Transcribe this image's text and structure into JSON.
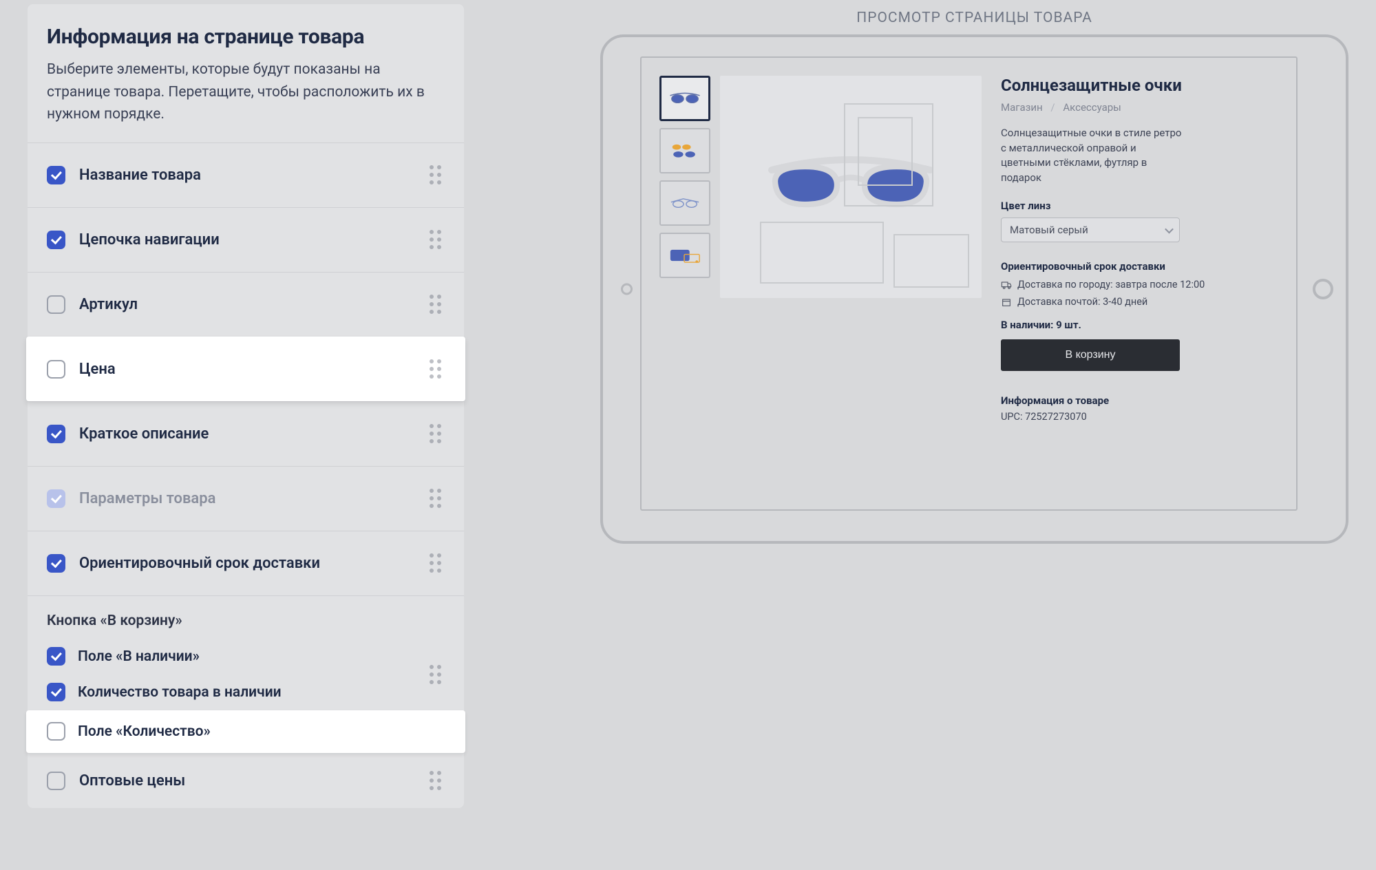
{
  "panel": {
    "title": "Информация на странице товара",
    "subtitle": "Выберите элементы, которые будут показаны на странице товара. Перетащите, чтобы расположить их в нужном порядке."
  },
  "items": [
    {
      "label": "Название товара",
      "checked": true,
      "state": "normal"
    },
    {
      "label": "Цепочка навигации",
      "checked": true,
      "state": "normal"
    },
    {
      "label": "Артикул",
      "checked": false,
      "state": "normal"
    },
    {
      "label": "Цена",
      "checked": false,
      "state": "active"
    },
    {
      "label": "Краткое описание",
      "checked": true,
      "state": "normal"
    },
    {
      "label": "Параметры товара",
      "checked": true,
      "state": "disabled"
    },
    {
      "label": "Ориентировочный срок доставки",
      "checked": true,
      "state": "normal"
    }
  ],
  "cartGroup": {
    "title": "Кнопка «В корзину»",
    "rows": [
      {
        "label": "Поле «В наличии»",
        "checked": true,
        "active": false
      },
      {
        "label": "Количество товара в наличии",
        "checked": true,
        "active": false
      },
      {
        "label": "Поле «Количество»",
        "checked": false,
        "active": true
      }
    ]
  },
  "extraRow": {
    "label": "Оптовые цены",
    "checked": false
  },
  "preview": {
    "heading": "ПРОСМОТР СТРАНИЦЫ ТОВАРА",
    "product": {
      "title": "Солнцезащитные очки",
      "crumb1": "Магазин",
      "crumb2": "Аксессуары",
      "description": "Солнцезащитные очки в стиле ретро с металлической оправой и цветными стёклами, футляр в подарок",
      "optionLabel": "Цвет линз",
      "optionValue": "Матовый серый",
      "deliveryHeader": "Ориентировочный срок доставки",
      "delivery1": "Доставка по городу: завтра после 12:00",
      "delivery2": "Доставка почтой: 3-40 дней",
      "stock": "В наличии: 9 шт.",
      "cartButton": "В корзину",
      "infoHeader": "Информация о товаре",
      "upc": "UPC: 72527273070"
    }
  },
  "colors": {
    "accent": "#3956c7",
    "textDark": "#1f2a44",
    "cartBtn": "#2a2d33"
  }
}
